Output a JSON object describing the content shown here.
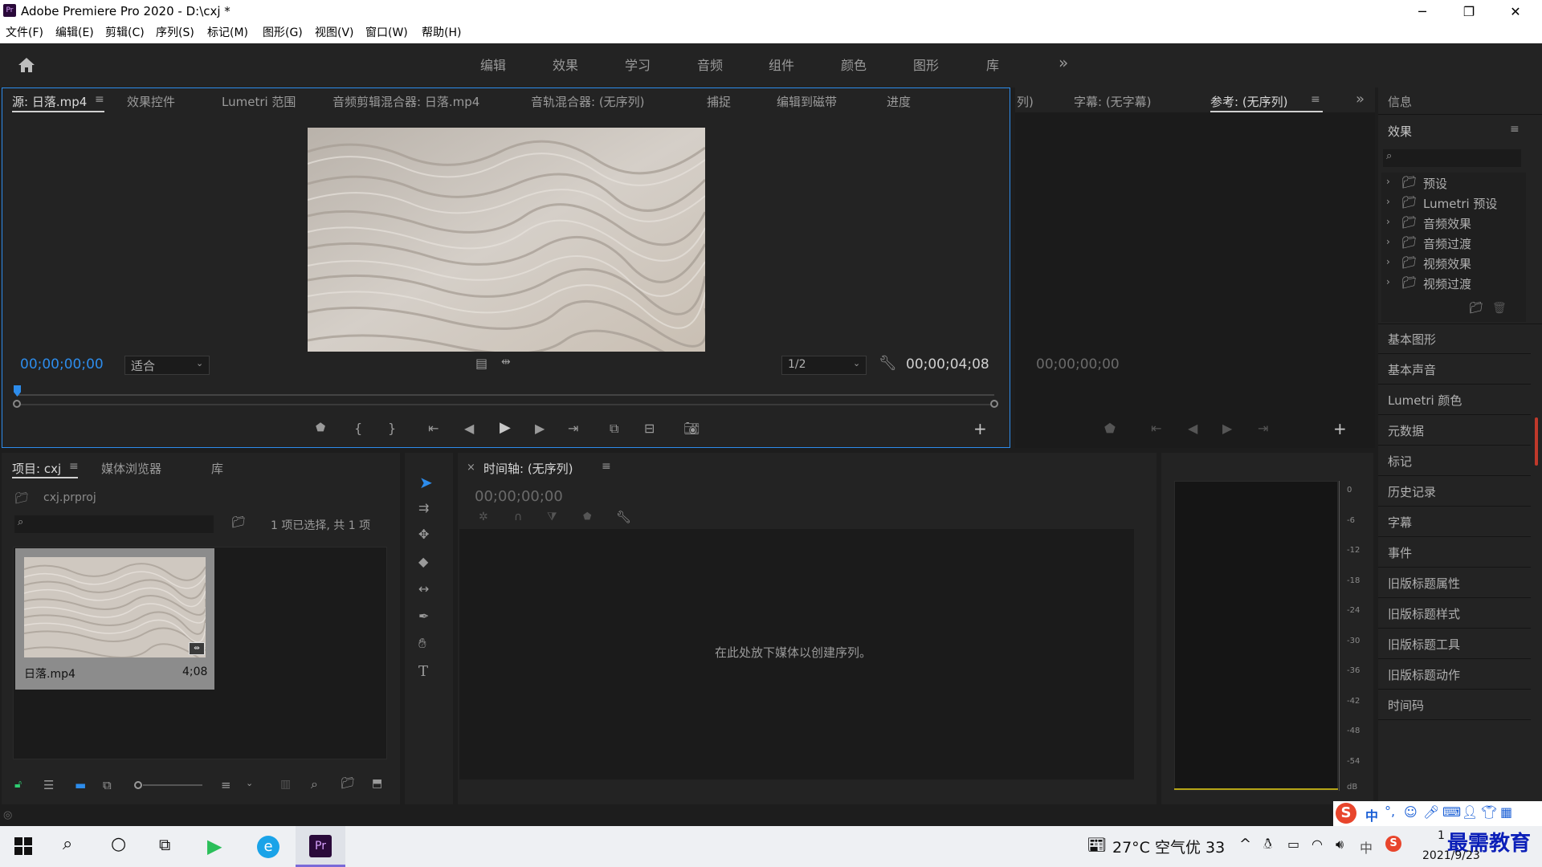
{
  "window": {
    "title": "Adobe Premiere Pro 2020 - D:\\cxj *",
    "app_icon_text": "Pr",
    "minimize": "─",
    "restore": "❐",
    "close": "✕"
  },
  "menu": [
    "文件(F)",
    "编辑(E)",
    "剪辑(C)",
    "序列(S)",
    "标记(M)",
    "图形(G)",
    "视图(V)",
    "窗口(W)",
    "帮助(H)"
  ],
  "workspaces": [
    "编辑",
    "效果",
    "学习",
    "音频",
    "组件",
    "颜色",
    "图形",
    "库"
  ],
  "source_panel": {
    "tabs": [
      "源: 日落.mp4",
      "效果控件",
      "Lumetri 范围",
      "音频剪辑混合器: 日落.mp4",
      "音轨混合器: (无序列)",
      "捕捉",
      "编辑到磁带",
      "进度"
    ],
    "timecode_left": "00;00;00;00",
    "fit_label": "适合",
    "resolution": "1/2",
    "timecode_right": "00;00;04;08"
  },
  "program_panel": {
    "tabs": [
      "列)",
      "字幕: (无字幕)",
      "参考: (无序列)"
    ],
    "timecode": "00;00;00;00"
  },
  "right_panel": {
    "info_label": "信息",
    "effects_label": "效果",
    "effects_tree": [
      "预设",
      "Lumetri 预设",
      "音频效果",
      "音频过渡",
      "视频效果",
      "视频过渡"
    ],
    "sections": [
      "基本图形",
      "基本声音",
      "Lumetri 颜色",
      "元数据",
      "标记",
      "历史记录",
      "字幕",
      "事件",
      "旧版标题属性",
      "旧版标题样式",
      "旧版标题工具",
      "旧版标题动作",
      "时间码"
    ]
  },
  "project_panel": {
    "tabs": [
      "项目: cxj",
      "媒体浏览器",
      "库"
    ],
    "project_file": "cxj.prproj",
    "selection_info": "1 项已选择, 共 1 项",
    "clip_name": "日落.mp4",
    "clip_duration": "4;08"
  },
  "timeline_panel": {
    "title": "时间轴: (无序列)",
    "close": "×",
    "timecode": "00;00;00;00",
    "drop_hint": "在此处放下媒体以创建序列。"
  },
  "audio_meter": {
    "labels": [
      "0",
      "-6",
      "-12",
      "-18",
      "-24",
      "-30",
      "-36",
      "-42",
      "-48",
      "-54",
      "dB"
    ]
  },
  "taskbar": {
    "weather": "27°C 空气优 33",
    "ime": "中",
    "date": "2021/9/23",
    "time_partial": "1",
    "watermark": "最需教育"
  },
  "colors": {
    "accent_blue": "#2d8ceb",
    "panel_bg": "#232323",
    "dark_bg": "#1b1b1b"
  }
}
